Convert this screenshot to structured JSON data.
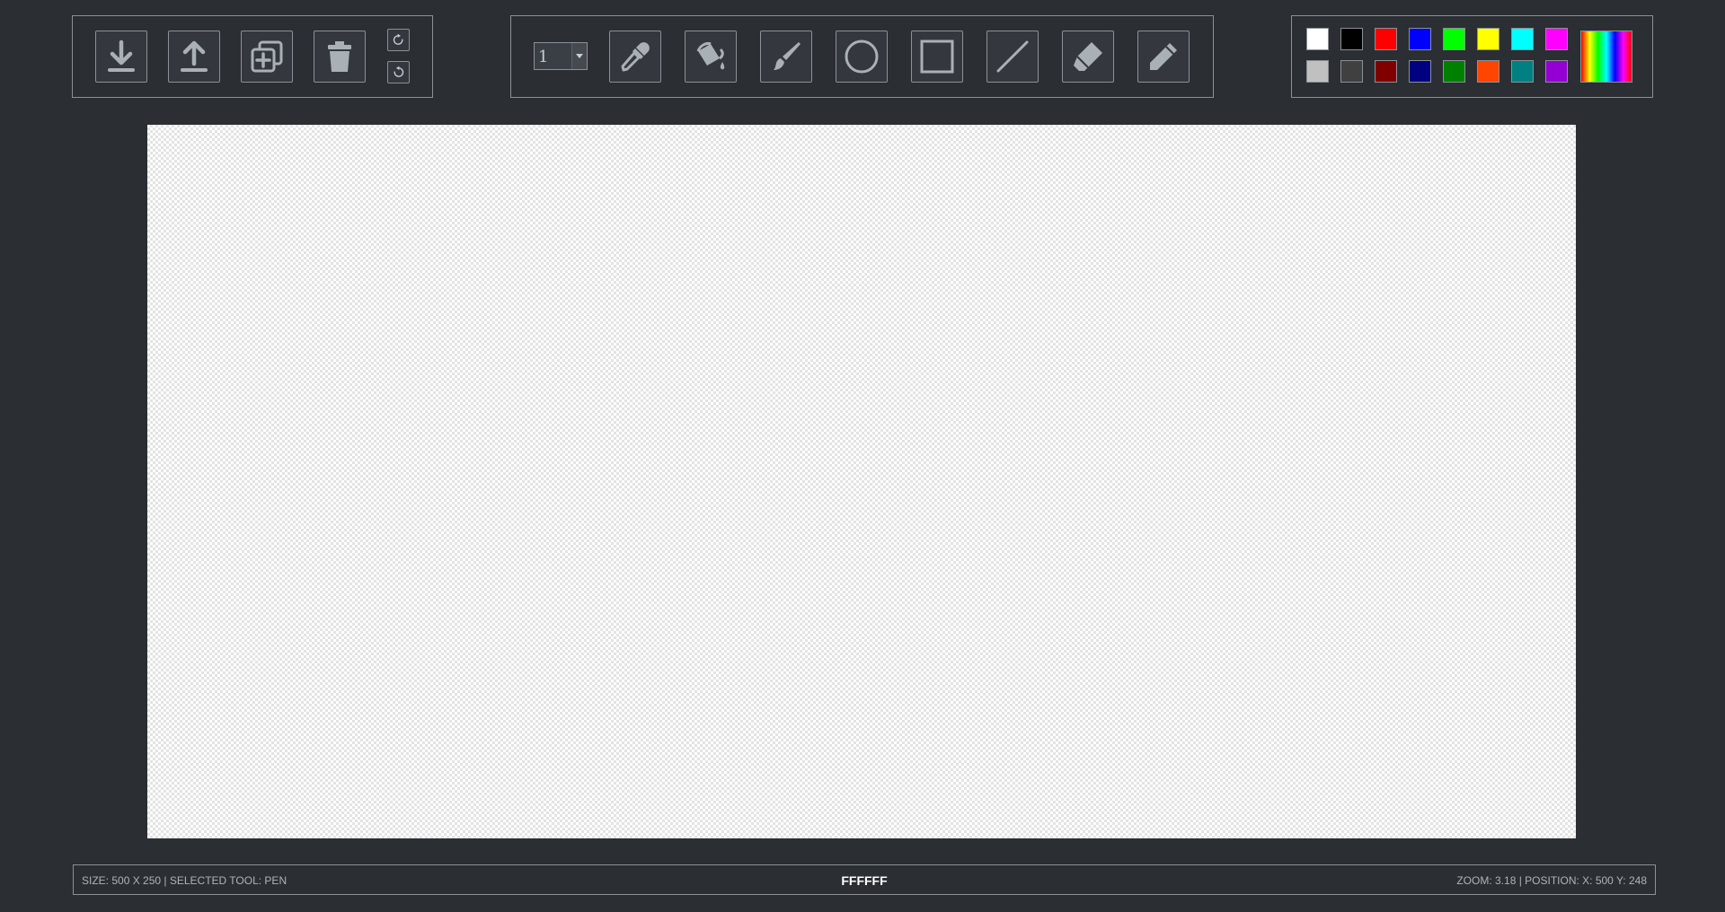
{
  "file_tools": [
    {
      "name": "download-button",
      "icon": "download-icon"
    },
    {
      "name": "upload-button",
      "icon": "upload-icon"
    },
    {
      "name": "new-layer-button",
      "icon": "add-layer-icon"
    },
    {
      "name": "delete-button",
      "icon": "trash-icon"
    }
  ],
  "history": {
    "redo_icon": "redo-icon",
    "undo_icon": "undo-icon"
  },
  "brush_size": {
    "value": "1"
  },
  "drawing_tools": [
    {
      "name": "eyedropper-tool",
      "icon": "eyedropper-icon"
    },
    {
      "name": "fill-tool",
      "icon": "paint-bucket-icon"
    },
    {
      "name": "brush-tool",
      "icon": "brush-icon"
    },
    {
      "name": "circle-tool",
      "icon": "circle-icon"
    },
    {
      "name": "rectangle-tool",
      "icon": "square-icon"
    },
    {
      "name": "line-tool",
      "icon": "line-icon"
    },
    {
      "name": "eraser-tool",
      "icon": "eraser-icon"
    },
    {
      "name": "pen-tool",
      "icon": "pencil-icon"
    }
  ],
  "palette": {
    "row1": [
      "#FFFFFF",
      "#000000",
      "#FF0000",
      "#0000FF",
      "#00FF00",
      "#FFFF00",
      "#00FFFF",
      "#FF00FF"
    ],
    "row2": [
      "#C0C0C0",
      "#404040",
      "#800000",
      "#000080",
      "#008000",
      "#FF4500",
      "#008080",
      "#9400D3"
    ],
    "spectrum_icon": "color-spectrum-picker"
  },
  "status": {
    "left": "SIZE: 500 X 250 | SELECTED TOOL: PEN",
    "color": "FFFFFF",
    "right": "ZOOM: 3.18 | POSITION: X: 500 Y: 248"
  }
}
